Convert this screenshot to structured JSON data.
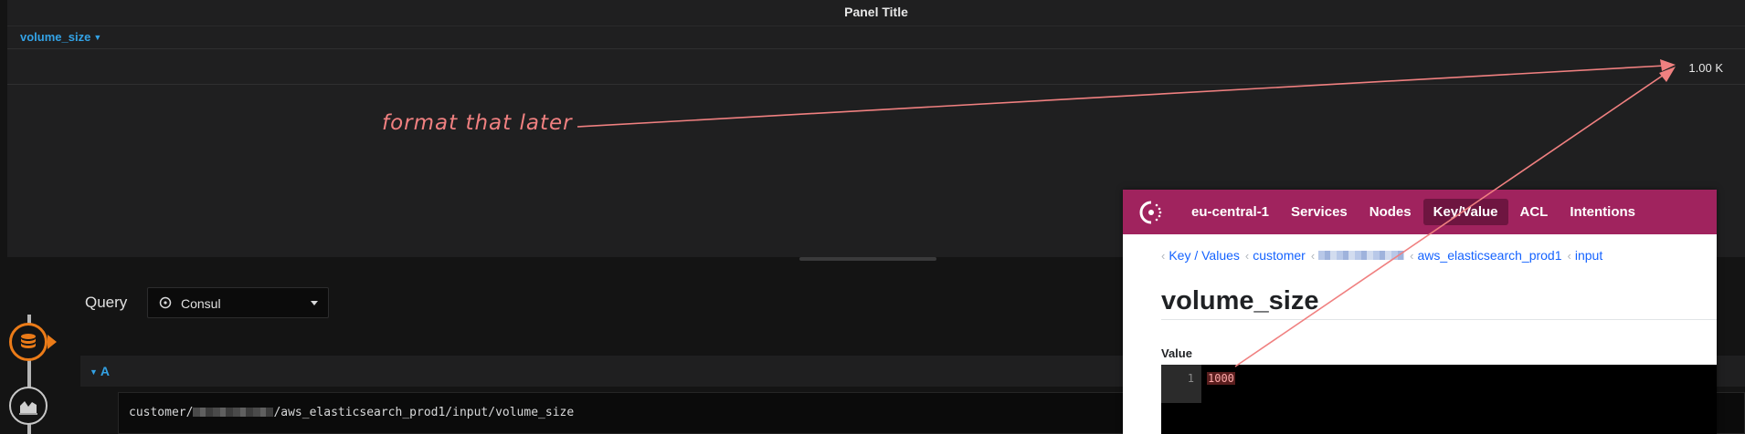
{
  "panel": {
    "title": "Panel Title",
    "variable": "volume_size",
    "legend_value": "1.00 K"
  },
  "query_editor": {
    "label": "Query",
    "datasource": {
      "name": "Consul",
      "icon": "consul-icon"
    },
    "query_ref": "A",
    "query_prefix": "customer/",
    "query_suffix": "/aws_elasticsearch_prod1/input/volume_size",
    "side_tabs": [
      {
        "icon": "database-icon",
        "active": true
      },
      {
        "icon": "area-chart-icon",
        "active": false
      }
    ]
  },
  "consul": {
    "datacenter": "eu-central-1",
    "nav": [
      "Services",
      "Nodes",
      "Key/Value",
      "ACL",
      "Intentions"
    ],
    "nav_active": "Key/Value",
    "breadcrumbs": {
      "root": "Key / Values",
      "customer": "customer",
      "service": "aws_elasticsearch_prod1",
      "folder": "input"
    },
    "key_title": "volume_size",
    "value_label": "Value",
    "editor": {
      "line_number": "1",
      "content": "1000"
    }
  },
  "annotation": {
    "text": "format that later",
    "color": "#f08080"
  },
  "colors": {
    "grafana_bg": "#141414",
    "panel_bg": "#1f1f20",
    "grafana_blue": "#33a2e5",
    "grafana_orange": "#eb7b18",
    "consul_brand": "#a0235e",
    "consul_link": "#1563ff"
  }
}
